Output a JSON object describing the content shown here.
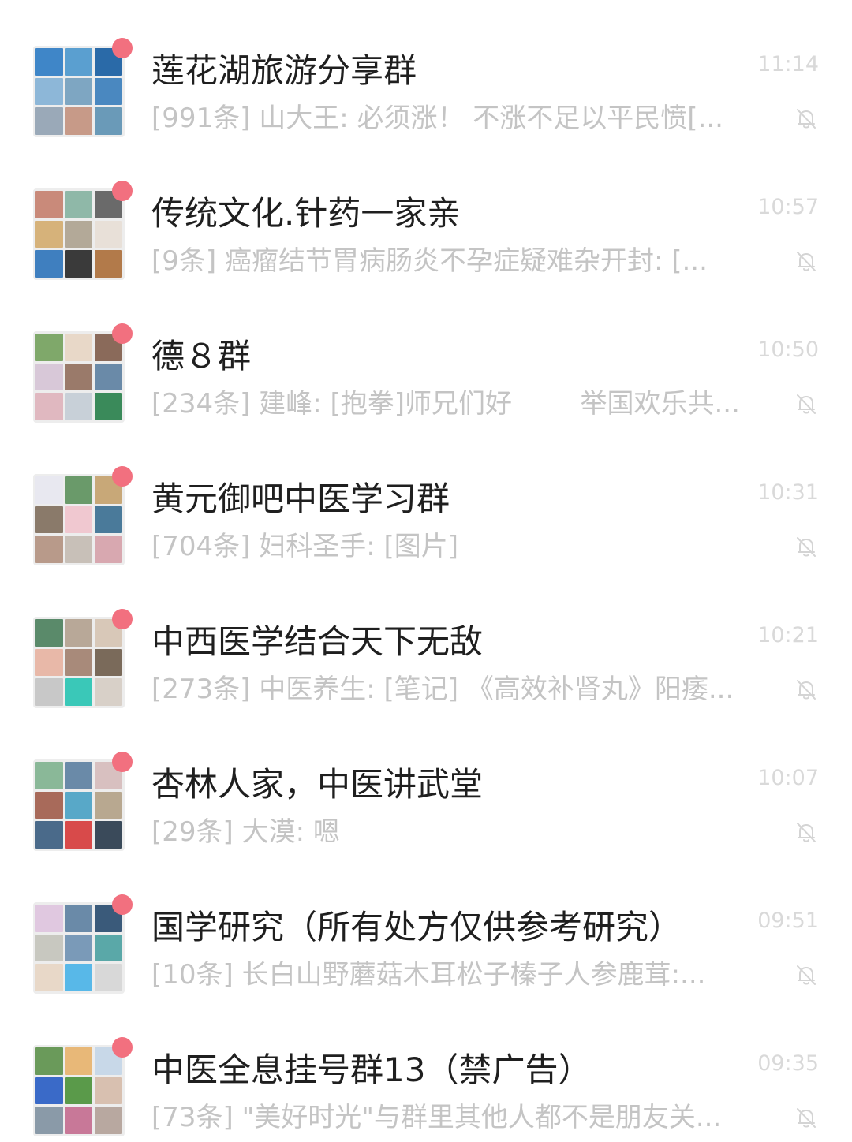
{
  "chats": [
    {
      "name": "莲花湖旅游分享群",
      "time": "11:14",
      "preview": "[991条] 山大王: 必须涨！ 不涨不足以平民愤[...",
      "unread": true,
      "muted": true,
      "tiles": [
        "#3f86c8",
        "#5a9fd0",
        "#2a6aa8",
        "#8db7d8",
        "#7ea6c2",
        "#4a88c0",
        "#9aa9b8",
        "#c79a88",
        "#6a9ab8"
      ]
    },
    {
      "name": "传统文化.针药一家亲",
      "time": "10:57",
      "preview": "[9条] 癌瘤结节胃病肠炎不孕症疑难杂开封: [...",
      "unread": true,
      "muted": true,
      "tiles": [
        "#c98a7a",
        "#8fb8a8",
        "#6a6a6a",
        "#d6b27a",
        "#b3a998",
        "#e8e0d8",
        "#3f7fbf",
        "#3a3a3a",
        "#b27a4a"
      ]
    },
    {
      "name": "德８群",
      "time": "10:50",
      "preview": "[234条] 建峰: [抱拳]师兄们好        举国欢乐共...",
      "unread": true,
      "muted": true,
      "tiles": [
        "#7fa86a",
        "#e8d8c8",
        "#8a6a5a",
        "#d8c8d8",
        "#9a7a6a",
        "#6a8aa8",
        "#e0b8c0",
        "#c8d0d8",
        "#3a8a5a"
      ]
    },
    {
      "name": "黄元御吧中医学习群",
      "time": "10:31",
      "preview": "[704条] 妇科圣手: [图片]",
      "unread": true,
      "muted": true,
      "tiles": [
        "#e8e8f0",
        "#6a9a6a",
        "#c8a878",
        "#8a7a6a",
        "#f0c8d0",
        "#4a7a9a",
        "#b89a8a",
        "#c8c0b8",
        "#d8a8b0"
      ]
    },
    {
      "name": "中西医学结合天下无敌",
      "time": "10:21",
      "preview": "[273条] 中医养生: [笔记] 《高效补肾丸》阳痿...",
      "unread": true,
      "muted": true,
      "tiles": [
        "#5a8a6a",
        "#b8a898",
        "#d8c8b8",
        "#e8b8a8",
        "#a88a7a",
        "#7a6a5a",
        "#c8c8c8",
        "#3ac8b8",
        "#d8d0c8"
      ]
    },
    {
      "name": "杏林人家，中医讲武堂",
      "time": "10:07",
      "preview": "[29条] 大漠: 嗯",
      "unread": true,
      "muted": true,
      "tiles": [
        "#8ab898",
        "#6a8aa8",
        "#d8c0c0",
        "#a86a5a",
        "#58a8c8",
        "#b8a890",
        "#4a6a8a",
        "#d84a4a",
        "#3a4a5a"
      ]
    },
    {
      "name": "国学研究（所有处方仅供参考研究）",
      "time": "09:51",
      "preview": "[10条] 长白山野蘑菇木耳松子榛子人参鹿茸:...",
      "unread": true,
      "muted": true,
      "tiles": [
        "#e0c8e0",
        "#6a8aa8",
        "#3a5a7a",
        "#c8c8c0",
        "#7a9ab8",
        "#5aa8a8",
        "#e8d8c8",
        "#58b8e8",
        "#d8d8d8"
      ]
    },
    {
      "name": "中医全息挂号群13（禁广告）",
      "time": "09:35",
      "preview": "[73条] \"美好时光\"与群里其他人都不是朋友关...",
      "unread": true,
      "muted": true,
      "tiles": [
        "#6a9a5a",
        "#e8b878",
        "#c8d8e8",
        "#3a6ac8",
        "#5a9a4a",
        "#d8c0b0",
        "#8a9aa8",
        "#c87898",
        "#b8a8a0"
      ]
    }
  ]
}
